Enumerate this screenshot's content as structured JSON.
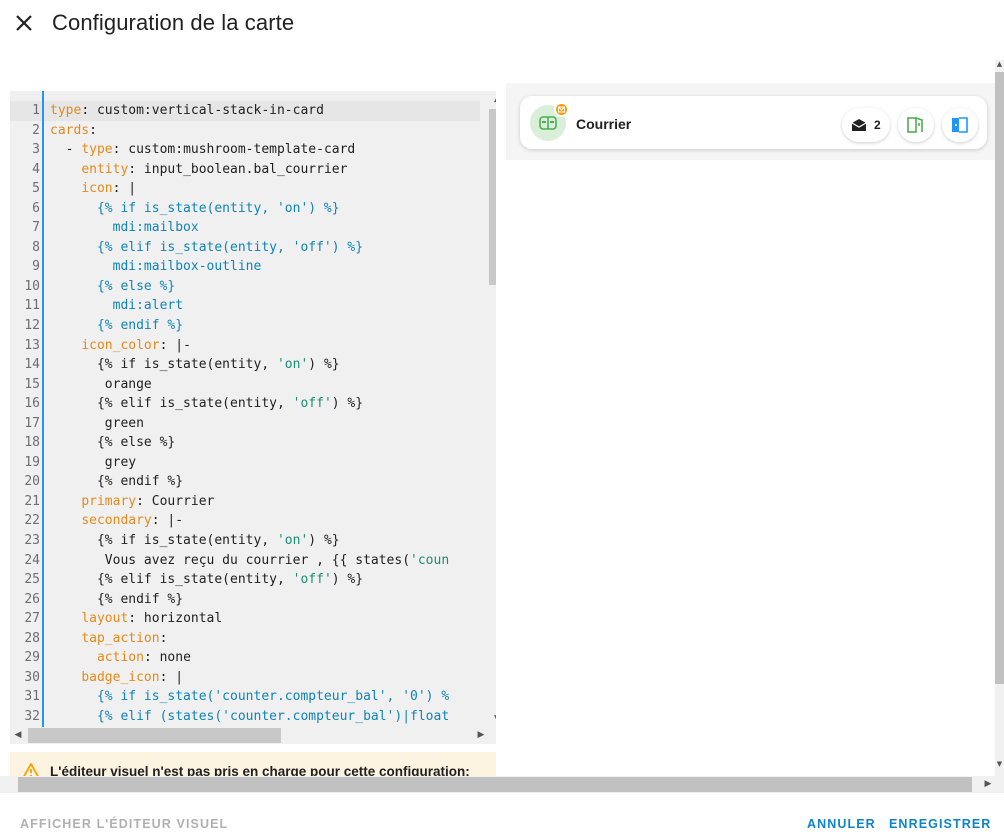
{
  "dialog": {
    "title": "Configuration de la carte"
  },
  "editor": {
    "lines": [
      {
        "n": "1",
        "parts": [
          {
            "c": "k",
            "t": "type"
          },
          {
            "c": "t",
            "t": ": custom:vertical-stack-in-card"
          }
        ]
      },
      {
        "n": "2",
        "parts": [
          {
            "c": "k",
            "t": "cards"
          },
          {
            "c": "t",
            "t": ":"
          }
        ]
      },
      {
        "n": "3",
        "parts": [
          {
            "c": "t",
            "t": "  - "
          },
          {
            "c": "k",
            "t": "type"
          },
          {
            "c": "t",
            "t": ": custom:mushroom-template-card"
          }
        ]
      },
      {
        "n": "4",
        "parts": [
          {
            "c": "t",
            "t": "    "
          },
          {
            "c": "k",
            "t": "entity"
          },
          {
            "c": "t",
            "t": ": input_boolean.bal_courrier"
          }
        ]
      },
      {
        "n": "5",
        "parts": [
          {
            "c": "t",
            "t": "    "
          },
          {
            "c": "k",
            "t": "icon"
          },
          {
            "c": "t",
            "t": ": |"
          }
        ]
      },
      {
        "n": "6",
        "parts": [
          {
            "c": "s",
            "t": "      {% if is_state(entity, 'on') %}"
          }
        ]
      },
      {
        "n": "7",
        "parts": [
          {
            "c": "s",
            "t": "        mdi:mailbox"
          }
        ]
      },
      {
        "n": "8",
        "parts": [
          {
            "c": "s",
            "t": "      {% elif is_state(entity, 'off') %}"
          }
        ]
      },
      {
        "n": "9",
        "parts": [
          {
            "c": "s",
            "t": "        mdi:mailbox-outline"
          }
        ]
      },
      {
        "n": "10",
        "parts": [
          {
            "c": "s",
            "t": "      {% else %}"
          }
        ]
      },
      {
        "n": "11",
        "parts": [
          {
            "c": "s",
            "t": "        mdi:alert"
          }
        ]
      },
      {
        "n": "12",
        "parts": [
          {
            "c": "s",
            "t": "      {% endif %}"
          }
        ]
      },
      {
        "n": "13",
        "parts": [
          {
            "c": "t",
            "t": "    "
          },
          {
            "c": "k",
            "t": "icon_color"
          },
          {
            "c": "t",
            "t": ": |-"
          }
        ]
      },
      {
        "n": "14",
        "parts": [
          {
            "c": "t",
            "t": "      {% if is_state(entity, "
          },
          {
            "c": "str",
            "t": "'on'"
          },
          {
            "c": "t",
            "t": ") %}"
          }
        ]
      },
      {
        "n": "15",
        "parts": [
          {
            "c": "t",
            "t": "       orange"
          }
        ]
      },
      {
        "n": "16",
        "parts": [
          {
            "c": "t",
            "t": "      {% elif is_state(entity, "
          },
          {
            "c": "str",
            "t": "'off'"
          },
          {
            "c": "t",
            "t": ") %}"
          }
        ]
      },
      {
        "n": "17",
        "parts": [
          {
            "c": "t",
            "t": "       green"
          }
        ]
      },
      {
        "n": "18",
        "parts": [
          {
            "c": "t",
            "t": "      {% else %}"
          }
        ]
      },
      {
        "n": "19",
        "parts": [
          {
            "c": "t",
            "t": "       grey"
          }
        ]
      },
      {
        "n": "20",
        "parts": [
          {
            "c": "t",
            "t": "      {% endif %}"
          }
        ]
      },
      {
        "n": "21",
        "parts": [
          {
            "c": "t",
            "t": "    "
          },
          {
            "c": "k",
            "t": "primary"
          },
          {
            "c": "t",
            "t": ": Courrier"
          }
        ]
      },
      {
        "n": "22",
        "parts": [
          {
            "c": "t",
            "t": "    "
          },
          {
            "c": "k",
            "t": "secondary"
          },
          {
            "c": "t",
            "t": ": |-"
          }
        ]
      },
      {
        "n": "23",
        "parts": [
          {
            "c": "t",
            "t": "      {% if is_state(entity, "
          },
          {
            "c": "str",
            "t": "'on'"
          },
          {
            "c": "t",
            "t": ") %}"
          }
        ]
      },
      {
        "n": "24",
        "parts": [
          {
            "c": "t",
            "t": "       Vous avez reçu du courrier , {{ states("
          },
          {
            "c": "str",
            "t": "'coun"
          }
        ]
      },
      {
        "n": "25",
        "parts": [
          {
            "c": "t",
            "t": "      {% elif is_state(entity, "
          },
          {
            "c": "str",
            "t": "'off'"
          },
          {
            "c": "t",
            "t": ") %}"
          }
        ]
      },
      {
        "n": "26",
        "parts": [
          {
            "c": "t",
            "t": "      {% endif %}"
          }
        ]
      },
      {
        "n": "27",
        "parts": [
          {
            "c": "t",
            "t": "    "
          },
          {
            "c": "k",
            "t": "layout"
          },
          {
            "c": "t",
            "t": ": horizontal"
          }
        ]
      },
      {
        "n": "28",
        "parts": [
          {
            "c": "t",
            "t": "    "
          },
          {
            "c": "k",
            "t": "tap_action"
          },
          {
            "c": "t",
            "t": ":"
          }
        ]
      },
      {
        "n": "29",
        "parts": [
          {
            "c": "t",
            "t": "      "
          },
          {
            "c": "k",
            "t": "action"
          },
          {
            "c": "t",
            "t": ": none"
          }
        ]
      },
      {
        "n": "30",
        "parts": [
          {
            "c": "t",
            "t": "    "
          },
          {
            "c": "k",
            "t": "badge_icon"
          },
          {
            "c": "t",
            "t": ": |"
          }
        ]
      },
      {
        "n": "31",
        "parts": [
          {
            "c": "s",
            "t": "      {% if is_state('counter.compteur_bal', '0') %"
          }
        ]
      },
      {
        "n": "32",
        "parts": [
          {
            "c": "s",
            "t": "      {% elif (states('counter.compteur_bal')|float"
          }
        ]
      }
    ],
    "active_line": "1"
  },
  "warning": {
    "text": "L'éditeur visuel n'est pas pris en charge pour cette configuration:"
  },
  "preview": {
    "card_title": "Courrier",
    "chip_count": "2",
    "icon_name": "mailbox-outline-icon",
    "badge_icon_name": "mail-icon",
    "colors": {
      "icon_green": "#4caf50",
      "badge_orange": "#ff9800",
      "door_green": "#4caf50",
      "door_blue": "#2196f3"
    }
  },
  "footer": {
    "visual_editor_label": "Afficher l'éditeur visuel",
    "cancel_label": "Annuler",
    "save_label": "Enregistrer"
  }
}
